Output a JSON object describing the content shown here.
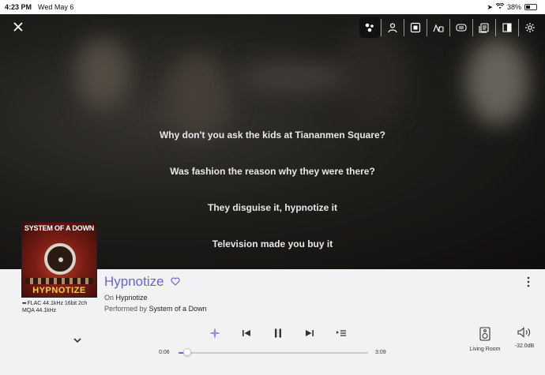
{
  "status_bar": {
    "time": "4:23 PM",
    "date": "Wed May 6",
    "battery": "38%",
    "battery_level": 0.38
  },
  "toolbar": {
    "close_icon": "close-icon",
    "tools": [
      {
        "name": "visualizer-icon",
        "active": true
      },
      {
        "name": "person-icon",
        "active": false
      },
      {
        "name": "album-square-icon",
        "active": false
      },
      {
        "name": "music-note-alt-icon",
        "active": false
      },
      {
        "name": "credits-icon",
        "active": false
      },
      {
        "name": "review-icon",
        "active": false
      },
      {
        "name": "booklet-icon",
        "active": false
      },
      {
        "name": "gear-icon",
        "active": false
      }
    ]
  },
  "lyrics": [
    "Why don't you ask the kids at Tiananmen Square?",
    "Was fashion the reason why they were there?",
    "They disguise it, hypnotize it",
    "Television made you buy it"
  ],
  "album_art": {
    "band": "SYSTEM OF A DOWN",
    "title": "HYPNOTIZE"
  },
  "format": {
    "line1": "FLAC 44.1kHz 16bit 2ch",
    "line2": "MQA 44.1kHz"
  },
  "track": {
    "title": "Hypnotize",
    "album_prefix": "On",
    "album": "Hypnotize",
    "artist_prefix": "Performed by",
    "artist": "System of a Down"
  },
  "playback": {
    "elapsed": "0:06",
    "duration": "3:09",
    "progress": 0.032
  },
  "output": {
    "zone": "Living Room",
    "volume": "-32.0dB"
  },
  "colors": {
    "accent": "#6a63d6"
  }
}
